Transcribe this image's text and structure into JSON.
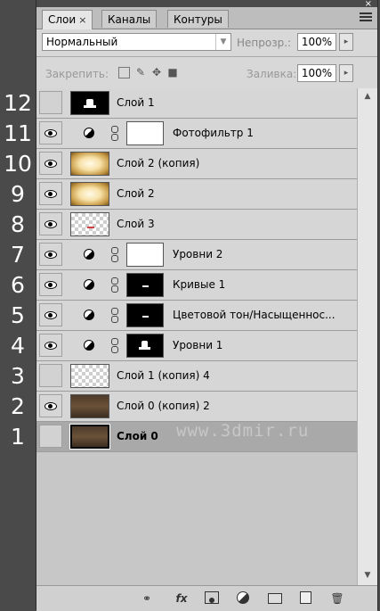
{
  "tabs": [
    {
      "label": "Слои",
      "close": "×"
    },
    {
      "label": "Каналы"
    },
    {
      "label": "Контуры"
    }
  ],
  "panel_close": "×",
  "blend_mode": "Нормальный",
  "opacity": {
    "label": "Непрозр.:",
    "value": "100%"
  },
  "lock": {
    "label": "Закрепить:"
  },
  "fill": {
    "label": "Заливка:",
    "value": "100%"
  },
  "row_numbers": [
    "12",
    "11",
    "10",
    "9",
    "8",
    "7",
    "6",
    "5",
    "4",
    "3",
    "2",
    "1"
  ],
  "layers": [
    {
      "name": "Слой 1",
      "visible": false,
      "adjustment": false,
      "thumb": "black-shape"
    },
    {
      "name": "Фотофильтр 1",
      "visible": true,
      "adjustment": true,
      "thumb": "white"
    },
    {
      "name": "Слой 2 (копия)",
      "visible": true,
      "adjustment": false,
      "thumb": "glow"
    },
    {
      "name": "Слой 2",
      "visible": true,
      "adjustment": false,
      "thumb": "glow"
    },
    {
      "name": "Слой 3",
      "visible": true,
      "adjustment": false,
      "thumb": "checker-red"
    },
    {
      "name": "Уровни 2",
      "visible": true,
      "adjustment": true,
      "thumb": "white"
    },
    {
      "name": "Кривые 1",
      "visible": true,
      "adjustment": true,
      "thumb": "black-small"
    },
    {
      "name": "Цветовой тон/Насыщеннос...",
      "visible": true,
      "adjustment": true,
      "thumb": "black-small"
    },
    {
      "name": "Уровни 1",
      "visible": true,
      "adjustment": true,
      "thumb": "black-shape"
    },
    {
      "name": "Слой 1 (копия) 4",
      "visible": false,
      "adjustment": false,
      "thumb": "checker"
    },
    {
      "name": "Слой 0 (копия) 2",
      "visible": true,
      "adjustment": false,
      "thumb": "room"
    },
    {
      "name": "Слой 0",
      "visible": false,
      "adjustment": false,
      "thumb": "room",
      "selected": true
    }
  ],
  "watermark": "www.3dmir.ru",
  "bottom_icons": [
    "link-icon",
    "fx-icon",
    "mask-icon",
    "adjustment-icon",
    "folder-icon",
    "new-layer-icon",
    "trash-icon"
  ],
  "bottom_fx": "fx"
}
